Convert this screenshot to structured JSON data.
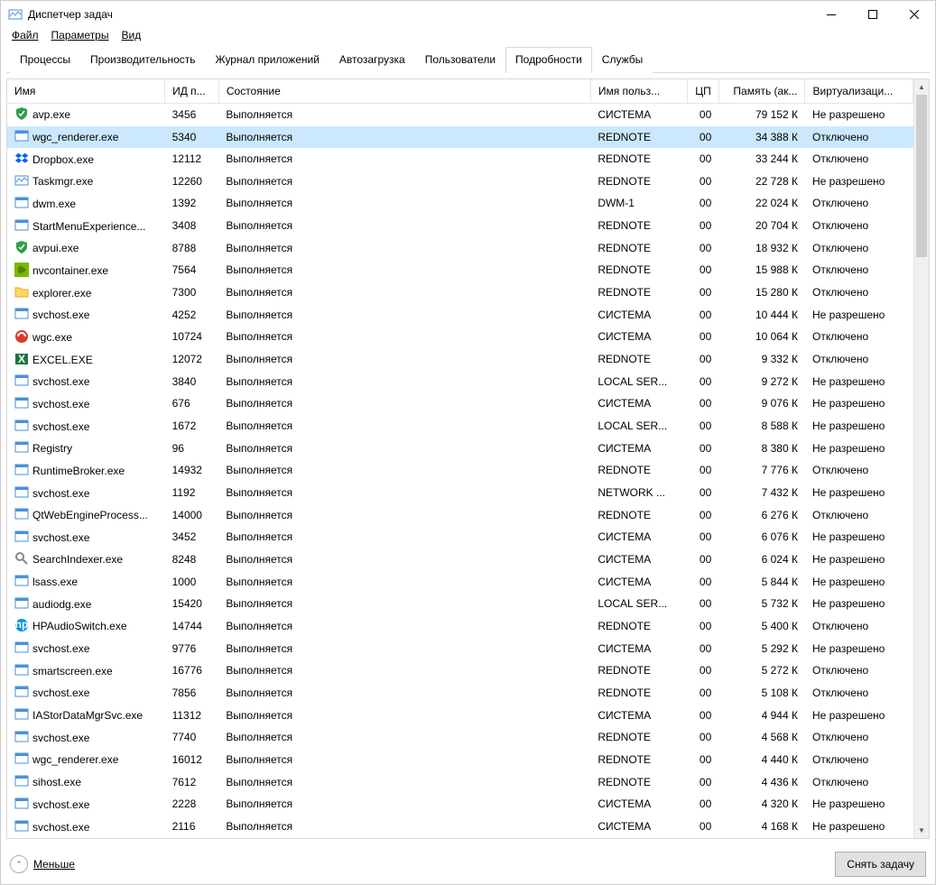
{
  "window": {
    "title": "Диспетчер задач"
  },
  "menu": {
    "file": "Файл",
    "options": "Параметры",
    "view": "Вид"
  },
  "tabs": [
    {
      "id": "processes",
      "label": "Процессы"
    },
    {
      "id": "performance",
      "label": "Производительность"
    },
    {
      "id": "apphistory",
      "label": "Журнал приложений"
    },
    {
      "id": "startup",
      "label": "Автозагрузка"
    },
    {
      "id": "users",
      "label": "Пользователи"
    },
    {
      "id": "details",
      "label": "Подробности",
      "active": true
    },
    {
      "id": "services",
      "label": "Службы"
    }
  ],
  "columns": {
    "name": "Имя",
    "pid": "ИД п...",
    "status": "Состояние",
    "user": "Имя польз...",
    "cpu": "ЦП",
    "memory": "Память (ак...",
    "virt": "Виртуализаци..."
  },
  "rows": [
    {
      "icon": "shield-green",
      "name": "avp.exe",
      "pid": "3456",
      "status": "Выполняется",
      "user": "СИСТЕМА",
      "cpu": "00",
      "mem": "79 152 К",
      "virt": "Не разрешено"
    },
    {
      "icon": "app-blue",
      "name": "wgc_renderer.exe",
      "pid": "5340",
      "status": "Выполняется",
      "user": "REDNOTE",
      "cpu": "00",
      "mem": "34 388 К",
      "virt": "Отключено",
      "selected": true
    },
    {
      "icon": "dropbox",
      "name": "Dropbox.exe",
      "pid": "12112",
      "status": "Выполняется",
      "user": "REDNOTE",
      "cpu": "00",
      "mem": "33 244 К",
      "virt": "Отключено"
    },
    {
      "icon": "taskmgr",
      "name": "Taskmgr.exe",
      "pid": "12260",
      "status": "Выполняется",
      "user": "REDNOTE",
      "cpu": "00",
      "mem": "22 728 К",
      "virt": "Не разрешено"
    },
    {
      "icon": "app-blue",
      "name": "dwm.exe",
      "pid": "1392",
      "status": "Выполняется",
      "user": "DWM-1",
      "cpu": "00",
      "mem": "22 024 К",
      "virt": "Отключено"
    },
    {
      "icon": "app-blue",
      "name": "StartMenuExperience...",
      "pid": "3408",
      "status": "Выполняется",
      "user": "REDNOTE",
      "cpu": "00",
      "mem": "20 704 К",
      "virt": "Отключено"
    },
    {
      "icon": "shield-green",
      "name": "avpui.exe",
      "pid": "8788",
      "status": "Выполняется",
      "user": "REDNOTE",
      "cpu": "00",
      "mem": "18 932 К",
      "virt": "Отключено"
    },
    {
      "icon": "nvidia",
      "name": "nvcontainer.exe",
      "pid": "7564",
      "status": "Выполняется",
      "user": "REDNOTE",
      "cpu": "00",
      "mem": "15 988 К",
      "virt": "Отключено"
    },
    {
      "icon": "explorer",
      "name": "explorer.exe",
      "pid": "7300",
      "status": "Выполняется",
      "user": "REDNOTE",
      "cpu": "00",
      "mem": "15 280 К",
      "virt": "Отключено"
    },
    {
      "icon": "app-blue",
      "name": "svchost.exe",
      "pid": "4252",
      "status": "Выполняется",
      "user": "СИСТЕМА",
      "cpu": "00",
      "mem": "10 444 К",
      "virt": "Не разрешено"
    },
    {
      "icon": "wgc",
      "name": "wgc.exe",
      "pid": "10724",
      "status": "Выполняется",
      "user": "СИСТЕМА",
      "cpu": "00",
      "mem": "10 064 К",
      "virt": "Отключено"
    },
    {
      "icon": "excel",
      "name": "EXCEL.EXE",
      "pid": "12072",
      "status": "Выполняется",
      "user": "REDNOTE",
      "cpu": "00",
      "mem": "9 332 К",
      "virt": "Отключено"
    },
    {
      "icon": "app-blue",
      "name": "svchost.exe",
      "pid": "3840",
      "status": "Выполняется",
      "user": "LOCAL SER...",
      "cpu": "00",
      "mem": "9 272 К",
      "virt": "Не разрешено"
    },
    {
      "icon": "app-blue",
      "name": "svchost.exe",
      "pid": "676",
      "status": "Выполняется",
      "user": "СИСТЕМА",
      "cpu": "00",
      "mem": "9 076 К",
      "virt": "Не разрешено"
    },
    {
      "icon": "app-blue",
      "name": "svchost.exe",
      "pid": "1672",
      "status": "Выполняется",
      "user": "LOCAL SER...",
      "cpu": "00",
      "mem": "8 588 К",
      "virt": "Не разрешено"
    },
    {
      "icon": "app-blue",
      "name": "Registry",
      "pid": "96",
      "status": "Выполняется",
      "user": "СИСТЕМА",
      "cpu": "00",
      "mem": "8 380 К",
      "virt": "Не разрешено"
    },
    {
      "icon": "app-blue",
      "name": "RuntimeBroker.exe",
      "pid": "14932",
      "status": "Выполняется",
      "user": "REDNOTE",
      "cpu": "00",
      "mem": "7 776 К",
      "virt": "Отключено"
    },
    {
      "icon": "app-blue",
      "name": "svchost.exe",
      "pid": "1192",
      "status": "Выполняется",
      "user": "NETWORK ...",
      "cpu": "00",
      "mem": "7 432 К",
      "virt": "Не разрешено"
    },
    {
      "icon": "app-blue",
      "name": "QtWebEngineProcess...",
      "pid": "14000",
      "status": "Выполняется",
      "user": "REDNOTE",
      "cpu": "00",
      "mem": "6 276 К",
      "virt": "Отключено"
    },
    {
      "icon": "app-blue",
      "name": "svchost.exe",
      "pid": "3452",
      "status": "Выполняется",
      "user": "СИСТЕМА",
      "cpu": "00",
      "mem": "6 076 К",
      "virt": "Не разрешено"
    },
    {
      "icon": "search",
      "name": "SearchIndexer.exe",
      "pid": "8248",
      "status": "Выполняется",
      "user": "СИСТЕМА",
      "cpu": "00",
      "mem": "6 024 К",
      "virt": "Не разрешено"
    },
    {
      "icon": "app-blue",
      "name": "lsass.exe",
      "pid": "1000",
      "status": "Выполняется",
      "user": "СИСТЕМА",
      "cpu": "00",
      "mem": "5 844 К",
      "virt": "Не разрешено"
    },
    {
      "icon": "app-blue",
      "name": "audiodg.exe",
      "pid": "15420",
      "status": "Выполняется",
      "user": "LOCAL SER...",
      "cpu": "00",
      "mem": "5 732 К",
      "virt": "Не разрешено"
    },
    {
      "icon": "hp",
      "name": "HPAudioSwitch.exe",
      "pid": "14744",
      "status": "Выполняется",
      "user": "REDNOTE",
      "cpu": "00",
      "mem": "5 400 К",
      "virt": "Отключено"
    },
    {
      "icon": "app-blue",
      "name": "svchost.exe",
      "pid": "9776",
      "status": "Выполняется",
      "user": "СИСТЕМА",
      "cpu": "00",
      "mem": "5 292 К",
      "virt": "Не разрешено"
    },
    {
      "icon": "app-blue",
      "name": "smartscreen.exe",
      "pid": "16776",
      "status": "Выполняется",
      "user": "REDNOTE",
      "cpu": "00",
      "mem": "5 272 К",
      "virt": "Отключено"
    },
    {
      "icon": "app-blue",
      "name": "svchost.exe",
      "pid": "7856",
      "status": "Выполняется",
      "user": "REDNOTE",
      "cpu": "00",
      "mem": "5 108 К",
      "virt": "Отключено"
    },
    {
      "icon": "app-blue",
      "name": "IAStorDataMgrSvc.exe",
      "pid": "11312",
      "status": "Выполняется",
      "user": "СИСТЕМА",
      "cpu": "00",
      "mem": "4 944 К",
      "virt": "Не разрешено"
    },
    {
      "icon": "app-blue",
      "name": "svchost.exe",
      "pid": "7740",
      "status": "Выполняется",
      "user": "REDNOTE",
      "cpu": "00",
      "mem": "4 568 К",
      "virt": "Отключено"
    },
    {
      "icon": "app-blue",
      "name": "wgc_renderer.exe",
      "pid": "16012",
      "status": "Выполняется",
      "user": "REDNOTE",
      "cpu": "00",
      "mem": "4 440 К",
      "virt": "Отключено"
    },
    {
      "icon": "app-blue",
      "name": "sihost.exe",
      "pid": "7612",
      "status": "Выполняется",
      "user": "REDNOTE",
      "cpu": "00",
      "mem": "4 436 К",
      "virt": "Отключено"
    },
    {
      "icon": "app-blue",
      "name": "svchost.exe",
      "pid": "2228",
      "status": "Выполняется",
      "user": "СИСТЕМА",
      "cpu": "00",
      "mem": "4 320 К",
      "virt": "Не разрешено"
    },
    {
      "icon": "app-blue",
      "name": "svchost.exe",
      "pid": "2116",
      "status": "Выполняется",
      "user": "СИСТЕМА",
      "cpu": "00",
      "mem": "4 168 К",
      "virt": "Не разрешено"
    }
  ],
  "footer": {
    "fewer": "Меньше",
    "endtask": "Снять задачу"
  }
}
